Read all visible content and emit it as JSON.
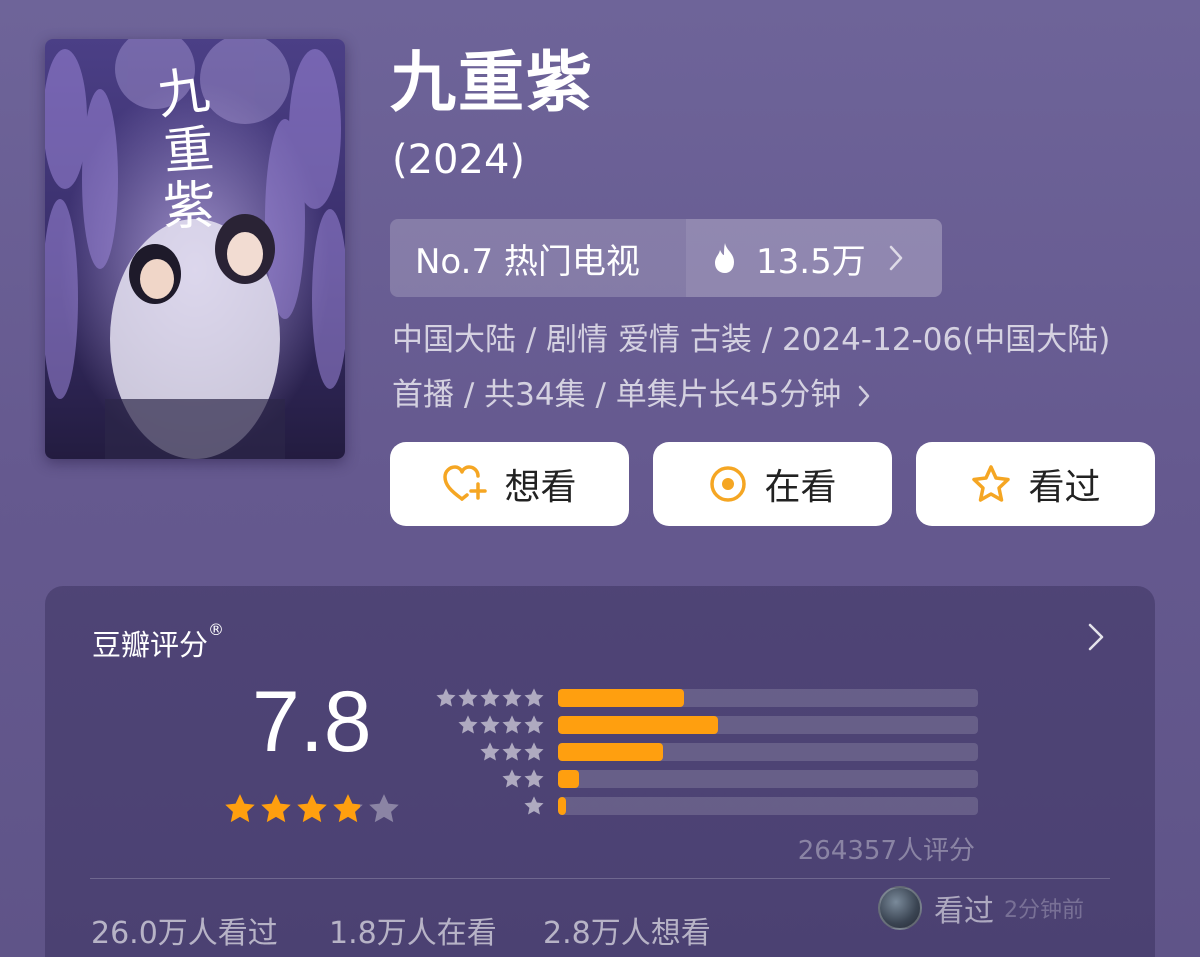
{
  "poster": {
    "title_art": "九重紫",
    "colors": {
      "sky": "#2b2350",
      "wisteria": "#9b86d8",
      "glow": "#c7b6f0"
    }
  },
  "title": "九重紫",
  "year": "(2024)",
  "ranking": {
    "rank_label": "No.7 热门电视",
    "heat_value": "13.5万",
    "flame_icon": "flame-icon"
  },
  "meta": {
    "line1": "中国大陆 / 剧情 爱情 古装 / 2024-12-06(中国大陆)",
    "line2": "首播 / 共34集 / 单集片长45分钟"
  },
  "actions": [
    {
      "label": "想看",
      "icon": "heart-plus-icon"
    },
    {
      "label": "在看",
      "icon": "target-circle-icon"
    },
    {
      "label": "看过",
      "icon": "star-outline-icon"
    }
  ],
  "rating": {
    "title": "豆瓣评分",
    "registered_mark": "®",
    "score": "7.8",
    "stars_filled": 3.9,
    "stars_total": 5,
    "distribution": [
      {
        "stars": 5,
        "fraction": 0.3
      },
      {
        "stars": 4,
        "fraction": 0.38
      },
      {
        "stars": 3,
        "fraction": 0.25
      },
      {
        "stars": 2,
        "fraction": 0.05
      },
      {
        "stars": 1,
        "fraction": 0.02
      }
    ],
    "count_label": "264357人评分"
  },
  "stats": {
    "watched": "26.0万人看过",
    "watching": "1.8万人在看",
    "want": "2.8万人想看"
  },
  "friend": {
    "label": "看过",
    "time": "2分钟前"
  },
  "colors": {
    "accent": "#ff9f0f",
    "background": "#6a5f96",
    "button_bg": "#ffffff"
  }
}
